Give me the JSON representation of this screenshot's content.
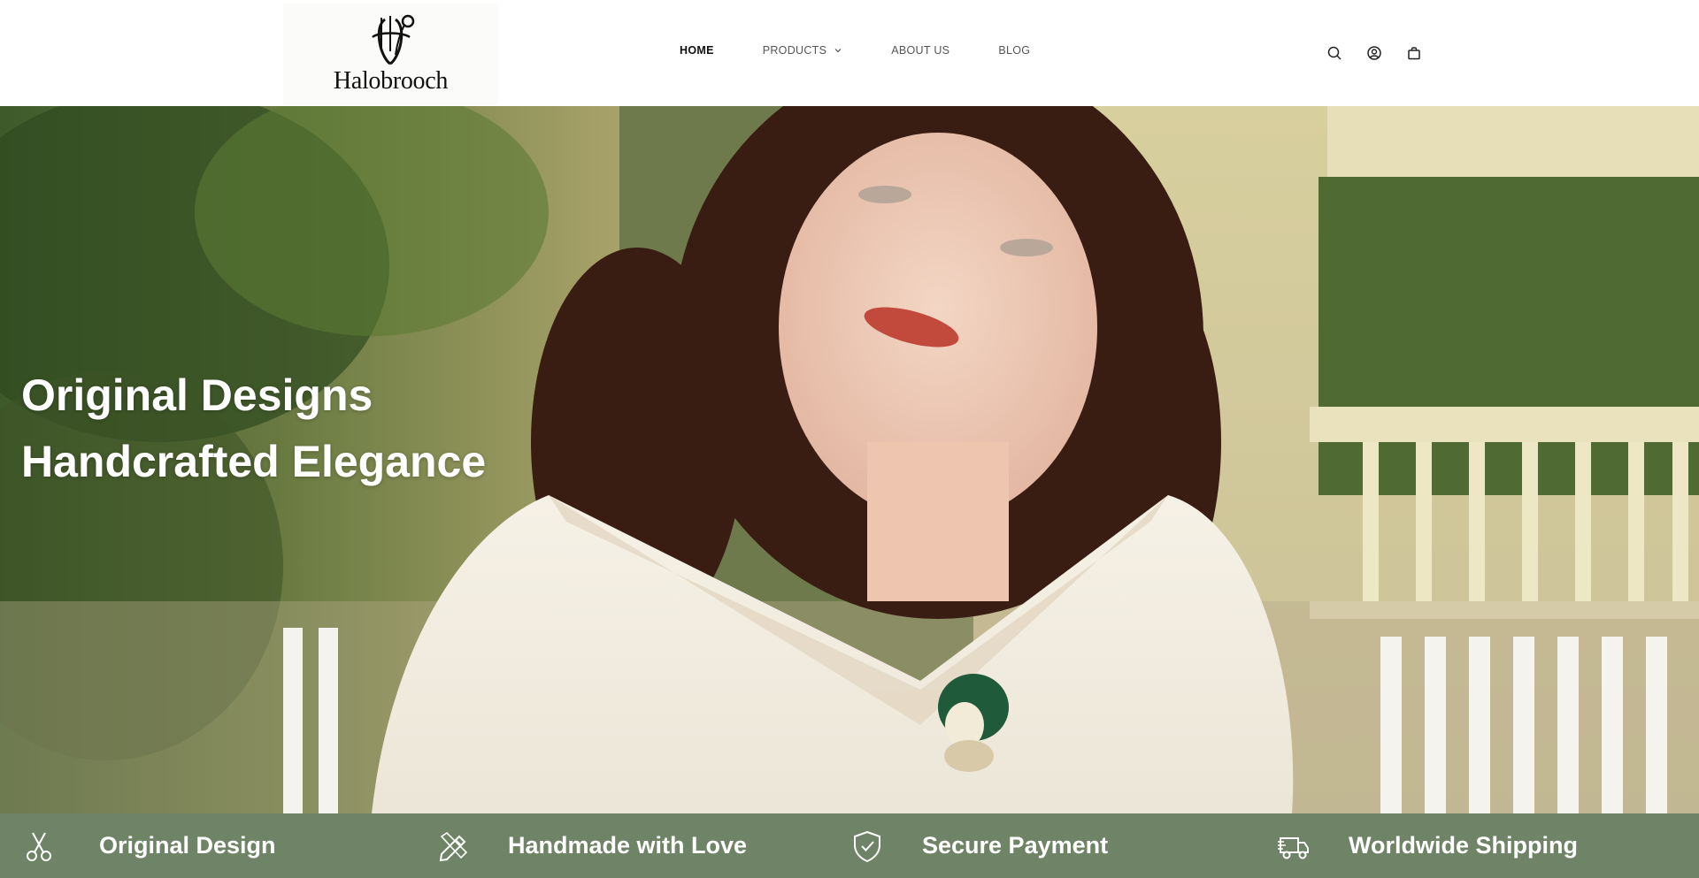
{
  "brand": {
    "name": "Halobrooch"
  },
  "nav": {
    "items": [
      {
        "label": "HOME",
        "active": true
      },
      {
        "label": "PRODUCTS",
        "has_dropdown": true
      },
      {
        "label": "ABOUT US"
      },
      {
        "label": "BLOG"
      }
    ]
  },
  "header_icons": [
    "search-icon",
    "account-icon",
    "cart-icon"
  ],
  "hero": {
    "line1": "Original Designs",
    "line2": "Handcrafted Elegance"
  },
  "features": [
    {
      "label": "Original Design",
      "icon": "scissors-icon"
    },
    {
      "label": "Handmade with Love",
      "icon": "pencil-ruler-icon"
    },
    {
      "label": "Secure Payment",
      "icon": "shield-check-icon"
    },
    {
      "label": "Worldwide Shipping",
      "icon": "truck-icon"
    }
  ],
  "colors": {
    "feature_bar": "#6f8466",
    "header_bg": "#ffffff",
    "nav_active": "#111111",
    "nav_text": "#555555"
  }
}
